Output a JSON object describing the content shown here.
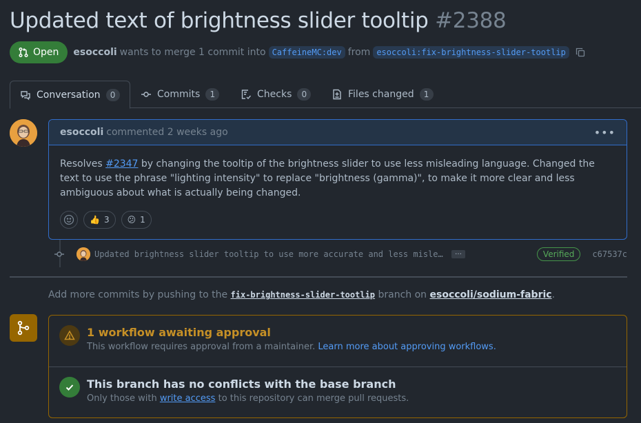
{
  "pr": {
    "title": "Updated text of brightness slider tooltip",
    "number": "#2388",
    "state": "Open",
    "author": "esoccoli",
    "merge_text_1": "wants to merge 1 commit into",
    "base_branch": "CaffeineMC:dev",
    "merge_text_2": "from",
    "head_branch": "esoccoli:fix-brightness-slider-tootlip"
  },
  "tabs": [
    {
      "label": "Conversation",
      "count": "0",
      "icon": "comment-discussion-icon"
    },
    {
      "label": "Commits",
      "count": "1",
      "icon": "git-commit-icon"
    },
    {
      "label": "Checks",
      "count": "0",
      "icon": "checklist-icon"
    },
    {
      "label": "Files changed",
      "count": "1",
      "icon": "file-diff-icon"
    }
  ],
  "comment": {
    "author": "esoccoli",
    "action": "commented",
    "time": "2 weeks ago",
    "body_prefix": "Resolves",
    "issue_link": "#2347",
    "body_suffix": " by changing the tooltip of the brightness slider to use less misleading language. Changed the text to use the phrase \"lighting intensity\" to replace \"brightness (gamma)\", to make it more clear and less ambiguous about what is actually being changed.",
    "reactions": [
      {
        "emoji": "👍",
        "count": "3"
      },
      {
        "emoji": "😕",
        "count": "1"
      }
    ]
  },
  "commit": {
    "message": "Updated brightness slider tooltip to use more accurate and less misleading language",
    "ellipsis": "…",
    "badge": "Verified",
    "sha": "c67537c"
  },
  "push_hint": {
    "prefix": "Add more commits by pushing to the",
    "branch": "fix-brightness-slider-tootlip",
    "middle": "branch on",
    "repo": "esoccoli/sodium-fabric",
    "suffix": "."
  },
  "merge_box": {
    "workflow_title": "1 workflow awaiting approval",
    "workflow_sub": "This workflow requires approval from a maintainer.",
    "workflow_link": "Learn more about approving workflows.",
    "conflict_title": "This branch has no conflicts with the base branch",
    "conflict_sub_prefix": "Only those with",
    "conflict_link": "write access",
    "conflict_sub_suffix": "to this repository can merge pull requests."
  },
  "colors": {
    "open_green": "#347d39",
    "link_blue": "#539bf5",
    "warning": "#c69026",
    "success": "#347d39"
  }
}
